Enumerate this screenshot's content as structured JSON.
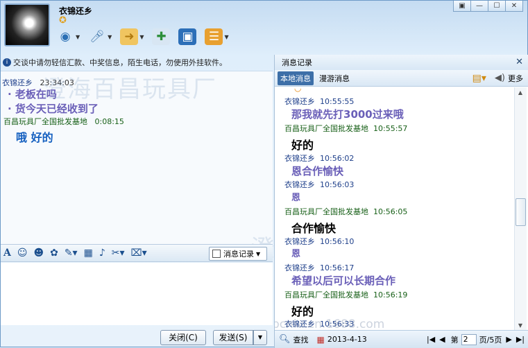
{
  "window": {
    "controls": [
      "▣",
      "—",
      "☐",
      "✕"
    ]
  },
  "contact": {
    "name": "衣锦还乡",
    "level_icon": "star"
  },
  "notice": "交谈中请勿轻信汇款、中奖信息，陌生电话，勿使用外挂软件。",
  "chat": [
    {
      "sender": "衣锦还乡",
      "time": "23:34:03"
    },
    {
      "lines": [
        "· 老板在吗",
        "· 货今天已经收到了"
      ]
    },
    {
      "sender": "百昌玩具厂全国批发基地",
      "time": "0:08:15"
    },
    {
      "text": "哦  好的"
    }
  ],
  "watermark": "澄海百昌玩具厂",
  "input_toolbar": {
    "history_label": "消息记录"
  },
  "buttons": {
    "close": "关闭(C)",
    "send": "发送(S)"
  },
  "history": {
    "title": "消息记录",
    "tabs": [
      "本地消息",
      "漫游消息"
    ],
    "more": "更多",
    "entries": [
      {
        "sender": "衣锦还乡",
        "time": "10:55:55",
        "text": "那我就先打3000过来哦"
      },
      {
        "sender": "百昌玩具厂全国批发基地",
        "time": "10:55:57",
        "text": "好的"
      },
      {
        "sender": "衣锦还乡",
        "time": "10:56:02",
        "text": "恩合作愉快"
      },
      {
        "sender": "衣锦还乡",
        "time": "10:56:03",
        "text": "恩"
      },
      {
        "sender": "百昌玩具厂全国批发基地",
        "time": "10:56:05",
        "text": "合作愉快"
      },
      {
        "sender": "衣锦还乡",
        "time": "10:56:10",
        "text": "恩"
      },
      {
        "sender": "衣锦还乡",
        "time": "10:56:17",
        "text": "希望以后可以长期合作"
      },
      {
        "sender": "百昌玩具厂全国批发基地",
        "time": "10:56:19",
        "text": "好的"
      },
      {
        "sender": "衣锦还乡",
        "time": "10:56:33"
      }
    ],
    "footer": {
      "search": "查找",
      "date": "2013-4-13",
      "page_label": "第",
      "page_value": "2",
      "total": "页/5页"
    },
    "site_watermark": "bcniu.cn.1688.com"
  }
}
